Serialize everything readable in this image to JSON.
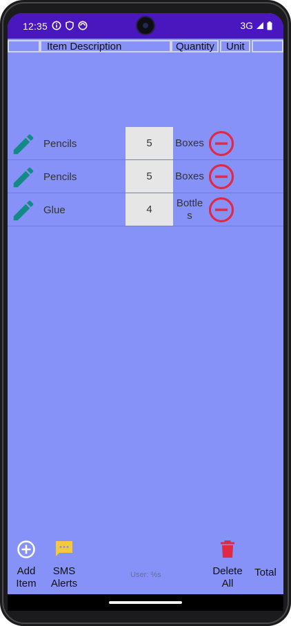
{
  "status_bar": {
    "time": "12:35",
    "network": "3G",
    "left_icons": [
      "info-icon",
      "shield-icon",
      "sync-icon"
    ],
    "right_icons": [
      "signal-icon",
      "battery-icon"
    ]
  },
  "table_header": {
    "col_blank": "",
    "col_description": "Item Description",
    "col_quantity": "Quantity",
    "col_unit": "Unit",
    "col_end": ""
  },
  "items": [
    {
      "name": "Pencils",
      "quantity": "5",
      "unit": "Boxes"
    },
    {
      "name": "Pencils",
      "quantity": "5",
      "unit": "Boxes"
    },
    {
      "name": "Glue",
      "quantity": "4",
      "unit": "Bottles"
    }
  ],
  "bottom_bar": {
    "add_item_label": "Add Item",
    "sms_alerts_label": "SMS Alerts",
    "user_label": "User: %s",
    "delete_all_label": "Delete All",
    "total_label": "Total"
  },
  "colors": {
    "background": "#8692f7",
    "status_bar": "#4a16be",
    "edit_icon": "#138a83",
    "remove_icon": "#e02a45",
    "sms_icon": "#f6c83b",
    "delete_icon": "#e02a45"
  }
}
